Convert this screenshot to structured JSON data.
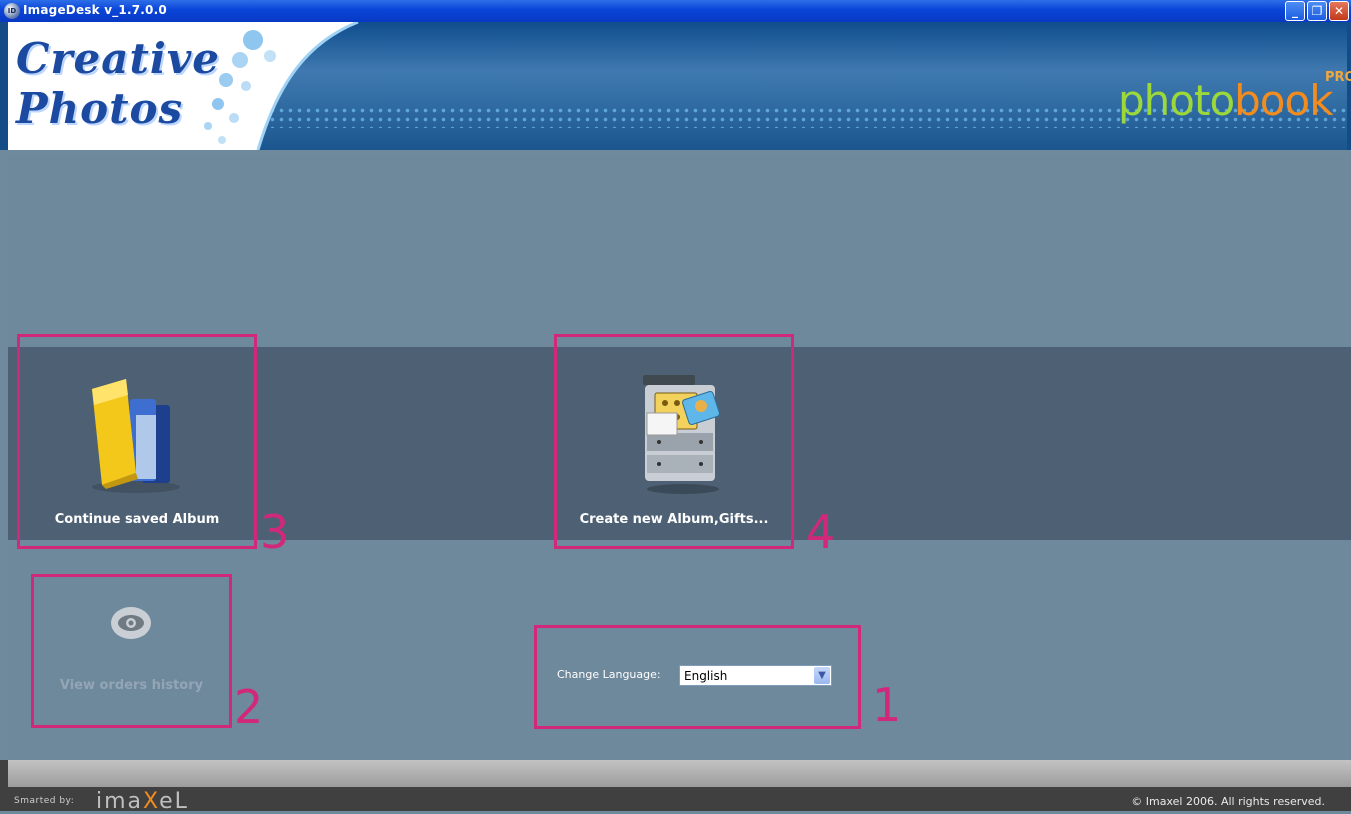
{
  "window": {
    "title": "ImageDesk v_1.7.0.0",
    "icon_text": "ID",
    "minimize_glyph": "_",
    "maximize_glyph": "❐",
    "close_glyph": "✕"
  },
  "banner": {
    "logo_line1": "Creative",
    "logo_line2": "Photos",
    "brand_part1": "photo",
    "brand_part2": "book",
    "brand_badge": "PRO"
  },
  "tiles": {
    "continue": {
      "label": "Continue saved Album"
    },
    "create": {
      "label": "Create new Album,Gifts..."
    },
    "history": {
      "label": "View orders history"
    }
  },
  "language": {
    "label": "Change Language:",
    "selected": "English"
  },
  "annotations": [
    "1",
    "2",
    "3",
    "4"
  ],
  "footer": {
    "smarted_by": "Smarted by:",
    "vendor_part1": "ima",
    "vendor_part2": "X",
    "vendor_part3": "eL",
    "copyright": "© Imaxel 2006. All rights reserved."
  },
  "colors": {
    "highlight": "#d1287a",
    "content_bg": "#6e889c",
    "band_bg": "#4e6174",
    "titlebar": "#0a45d8"
  }
}
